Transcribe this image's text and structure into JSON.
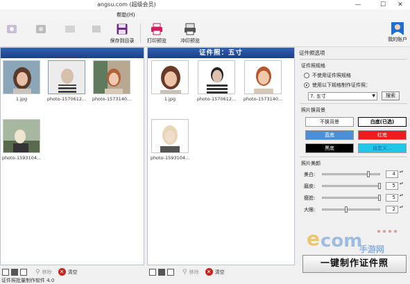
{
  "window": {
    "title": "angsu.com (超级会员)",
    "controls": {
      "minimize": "—",
      "maximize": "☐",
      "close": "✕"
    }
  },
  "menu": {
    "help": "帮助(H)"
  },
  "toolbar": {
    "buttons": [
      {
        "label": "",
        "icon": "app-icon"
      },
      {
        "label": "",
        "icon": "app-icon-2"
      },
      {
        "label": "",
        "icon": "app-icon-3"
      },
      {
        "label": "",
        "icon": "app-icon-4"
      },
      {
        "label": "保存到目录",
        "icon": "save-icon"
      },
      {
        "label": "打印预览",
        "icon": "print-icon"
      },
      {
        "label": "冲印预览",
        "icon": "photo-print-icon"
      }
    ],
    "account": "我的账户"
  },
  "left_panel": {
    "header": "",
    "images": [
      {
        "caption": "1.jpg"
      },
      {
        "caption": "photo-1570612..."
      },
      {
        "caption": "photo-1573140..."
      },
      {
        "caption": "photo-1593104..."
      }
    ],
    "footer": {
      "remove": "移除",
      "clear": "清空"
    }
  },
  "right_panel": {
    "header": "证件照：五寸",
    "images": [
      {
        "caption": "1.jpg"
      },
      {
        "caption": "photo-1570612..."
      },
      {
        "caption": "photo-1573140..."
      },
      {
        "caption": "photo-1593104..."
      }
    ],
    "footer": {
      "remove": "移除",
      "clear": "清空"
    }
  },
  "options": {
    "title": "证件照选项",
    "spec": {
      "title": "证件照规格",
      "opt_none": "不使用证件照规格",
      "opt_use": "使用以下规格制作证件照：",
      "selected": "7. 五寸",
      "search": "搜索"
    },
    "background": {
      "title": "照片换背景",
      "buttons": [
        {
          "label": "不换背景",
          "bg": "#ffffff",
          "fg": "#222222"
        },
        {
          "label": "白底(已选)",
          "bg": "#ffffff",
          "fg": "#000000"
        },
        {
          "label": "蓝底",
          "bg": "#4a8fd8",
          "fg": "#ffffff"
        },
        {
          "label": "红底",
          "bg": "#ee1c1c",
          "fg": "#ffffff"
        },
        {
          "label": "黑底",
          "bg": "#000000",
          "fg": "#ffffff"
        },
        {
          "label": "自定义...",
          "bg": "#22c6e8",
          "fg": "#1d5ea8"
        }
      ]
    },
    "beauty": {
      "title": "照片美颜",
      "sliders": [
        {
          "label": "美白:",
          "value": "4",
          "level": 0.8
        },
        {
          "label": "磨皮:",
          "value": "5",
          "level": 1.0
        },
        {
          "label": "瘦脸:",
          "value": "5",
          "level": 1.0
        },
        {
          "label": "大眼:",
          "value": "2",
          "level": 0.4
        }
      ]
    },
    "make_button": "一键制作证件照"
  },
  "watermark": {
    "text": "手游网"
  },
  "status": "证件照批量制作软件 4.0"
}
